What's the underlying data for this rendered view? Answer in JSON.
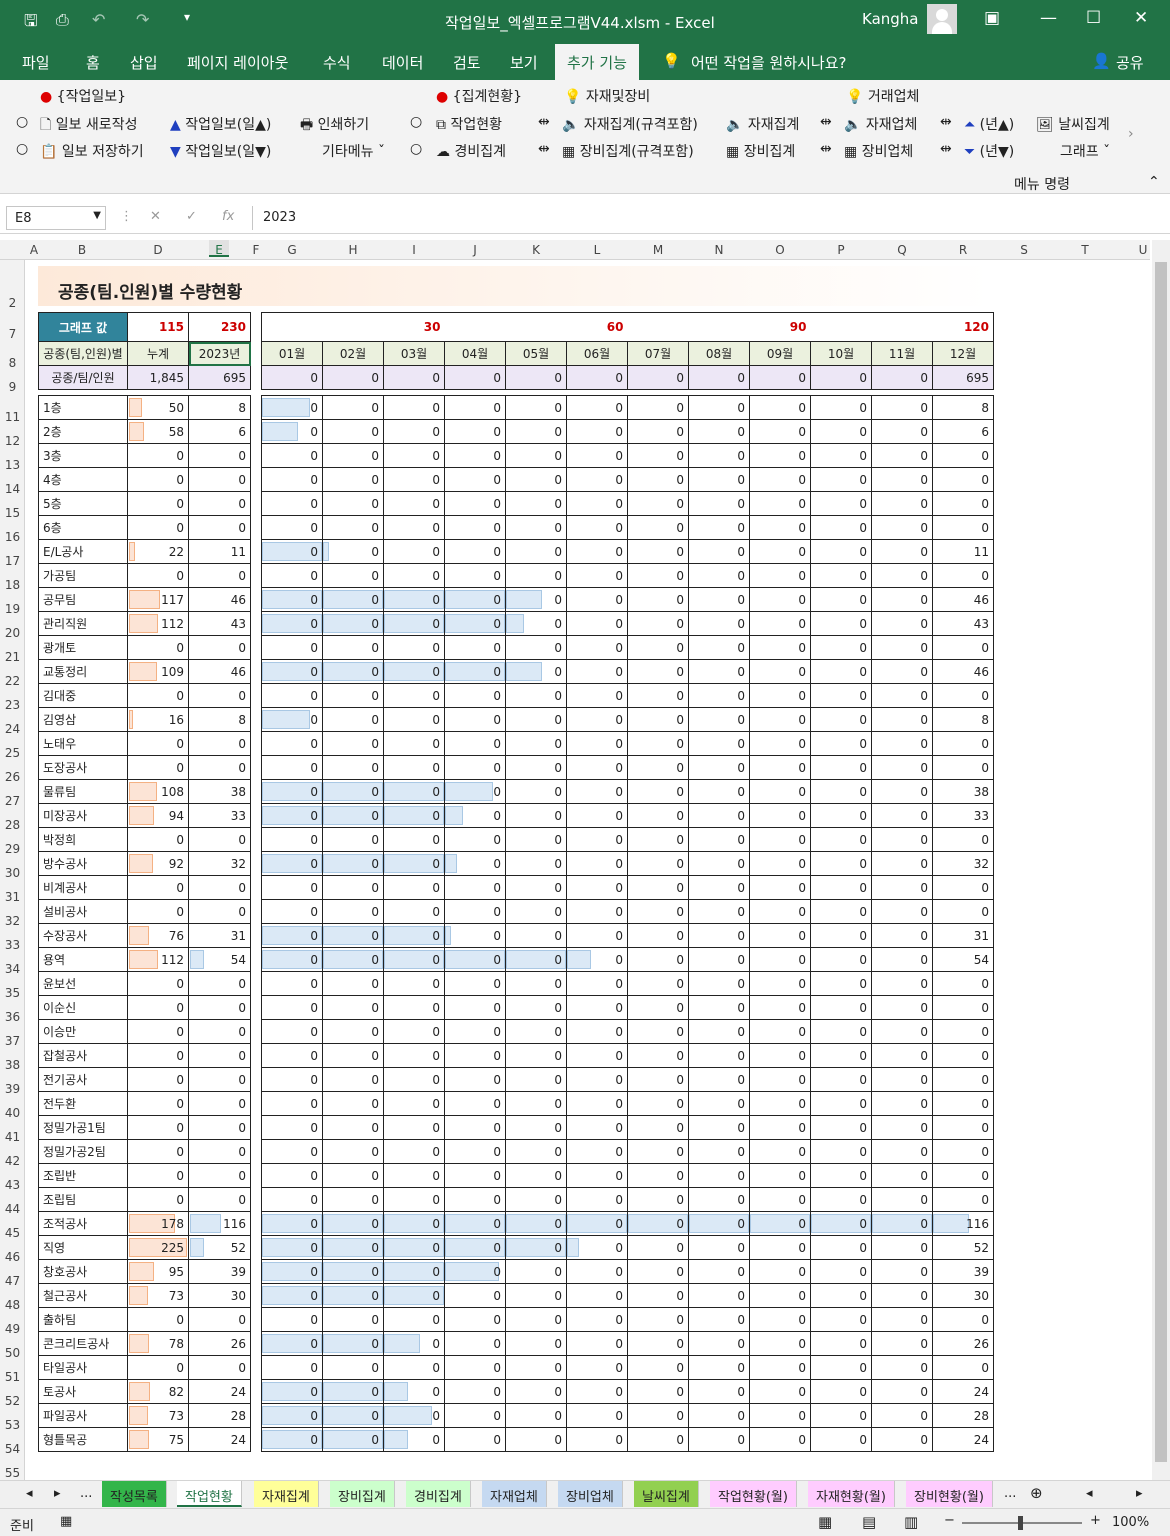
{
  "window": {
    "title": "작업일보_엑셀프로그램V44.xlsm  -  Excel",
    "user": "Kangha"
  },
  "tabs": [
    "파일",
    "홈",
    "삽입",
    "페이지 레이아웃",
    "수식",
    "데이터",
    "검토",
    "보기",
    "추가 기능"
  ],
  "tell_me": "어떤 작업을 원하시나요?",
  "share": "공유",
  "ribbon": {
    "g1_title": "{작업일보}",
    "new_report": "일보 새로작성",
    "save_report": "일보 저장하기",
    "rep_up": "작업일보(일▲)",
    "rep_down": "작업일보(일▼)",
    "print": "인쇄하기",
    "other_menu": "기타메뉴",
    "g2_title": "{집계현황}",
    "work_status": "작업현황",
    "cost_agg": "경비집계",
    "g3_title": "자재및장비",
    "mat_agg_spec": "자재집계(규격포함)",
    "mat_agg": "자재집계",
    "eq_agg_spec": "장비집계(규격포함)",
    "eq_agg": "장비집계",
    "g4_title": "거래업체",
    "mat_vendor": "자재업체",
    "eq_vendor": "장비업체",
    "year_up": "(년▲)",
    "year_down": "(년▼)",
    "weather": "날씨집계",
    "graph": "그래프",
    "menu_cmd": "메뉴 명령"
  },
  "formula": {
    "namebox": "E8",
    "value": "2023"
  },
  "columns": [
    "A",
    "B",
    "D",
    "E",
    "F",
    "G",
    "H",
    "I",
    "J",
    "K",
    "L",
    "M",
    "N",
    "O",
    "P",
    "Q",
    "R",
    "S",
    "T",
    "U"
  ],
  "sheet": {
    "title": "공종(팀.인원)별 수량현황",
    "graph_label": "그래프 값",
    "graph_values": [
      "115",
      "230"
    ],
    "scale_values": [
      "30",
      "60",
      "90",
      "120"
    ],
    "h_name": "공종(팀,인원)별",
    "h_cum": "누계",
    "h_year": "2023년",
    "months": [
      "01월",
      "02월",
      "03월",
      "04월",
      "05월",
      "06월",
      "07월",
      "08월",
      "09월",
      "10월",
      "11월",
      "12월"
    ],
    "sum_label": "공종/팀/인원",
    "sum_cum": "1,845",
    "sum_year": "695",
    "sum_months": [
      "0",
      "0",
      "0",
      "0",
      "0",
      "0",
      "0",
      "0",
      "0",
      "0",
      "0",
      "695"
    ],
    "rows": [
      {
        "r": "11",
        "name": "1층",
        "cum": 50,
        "year": 8
      },
      {
        "r": "12",
        "name": "2층",
        "cum": 58,
        "year": 6
      },
      {
        "r": "13",
        "name": "3층",
        "cum": 0,
        "year": 0
      },
      {
        "r": "14",
        "name": "4층",
        "cum": 0,
        "year": 0
      },
      {
        "r": "15",
        "name": "5층",
        "cum": 0,
        "year": 0
      },
      {
        "r": "16",
        "name": "6층",
        "cum": 0,
        "year": 0
      },
      {
        "r": "17",
        "name": "E/L공사",
        "cum": 22,
        "year": 11
      },
      {
        "r": "18",
        "name": "가공팀",
        "cum": 0,
        "year": 0
      },
      {
        "r": "19",
        "name": "공무팀",
        "cum": 117,
        "year": 46
      },
      {
        "r": "20",
        "name": "관리직원",
        "cum": 112,
        "year": 43
      },
      {
        "r": "21",
        "name": "광개토",
        "cum": 0,
        "year": 0
      },
      {
        "r": "22",
        "name": "교통정리",
        "cum": 109,
        "year": 46
      },
      {
        "r": "23",
        "name": "김대중",
        "cum": 0,
        "year": 0
      },
      {
        "r": "24",
        "name": "김영삼",
        "cum": 16,
        "year": 8
      },
      {
        "r": "25",
        "name": "노태우",
        "cum": 0,
        "year": 0
      },
      {
        "r": "26",
        "name": "도장공사",
        "cum": 0,
        "year": 0
      },
      {
        "r": "27",
        "name": "물류팀",
        "cum": 108,
        "year": 38
      },
      {
        "r": "28",
        "name": "미장공사",
        "cum": 94,
        "year": 33
      },
      {
        "r": "29",
        "name": "박정희",
        "cum": 0,
        "year": 0
      },
      {
        "r": "30",
        "name": "방수공사",
        "cum": 92,
        "year": 32
      },
      {
        "r": "31",
        "name": "비계공사",
        "cum": 0,
        "year": 0
      },
      {
        "r": "32",
        "name": "설비공사",
        "cum": 0,
        "year": 0
      },
      {
        "r": "33",
        "name": "수장공사",
        "cum": 76,
        "year": 31
      },
      {
        "r": "34",
        "name": "용역",
        "cum": 112,
        "year": 54
      },
      {
        "r": "35",
        "name": "윤보선",
        "cum": 0,
        "year": 0
      },
      {
        "r": "36",
        "name": "이순신",
        "cum": 0,
        "year": 0
      },
      {
        "r": "37",
        "name": "이승만",
        "cum": 0,
        "year": 0
      },
      {
        "r": "38",
        "name": "잡철공사",
        "cum": 0,
        "year": 0
      },
      {
        "r": "39",
        "name": "전기공사",
        "cum": 0,
        "year": 0
      },
      {
        "r": "40",
        "name": "전두환",
        "cum": 0,
        "year": 0
      },
      {
        "r": "41",
        "name": "정밀가공1팀",
        "cum": 0,
        "year": 0
      },
      {
        "r": "42",
        "name": "정밀가공2팀",
        "cum": 0,
        "year": 0
      },
      {
        "r": "43",
        "name": "조립반",
        "cum": 0,
        "year": 0
      },
      {
        "r": "44",
        "name": "조립팀",
        "cum": 0,
        "year": 0
      },
      {
        "r": "45",
        "name": "조적공사",
        "cum": 178,
        "year": 116
      },
      {
        "r": "46",
        "name": "직영",
        "cum": 225,
        "year": 52
      },
      {
        "r": "47",
        "name": "창호공사",
        "cum": 95,
        "year": 39
      },
      {
        "r": "48",
        "name": "철근공사",
        "cum": 73,
        "year": 30
      },
      {
        "r": "49",
        "name": "출하팀",
        "cum": 0,
        "year": 0
      },
      {
        "r": "50",
        "name": "콘크리트공사",
        "cum": 78,
        "year": 26
      },
      {
        "r": "51",
        "name": "타일공사",
        "cum": 0,
        "year": 0
      },
      {
        "r": "52",
        "name": "토공사",
        "cum": 82,
        "year": 24
      },
      {
        "r": "53",
        "name": "파일공사",
        "cum": 73,
        "year": 28
      },
      {
        "r": "54",
        "name": "형틀목공",
        "cum": 75,
        "year": 24
      }
    ]
  },
  "sheet_tabs": [
    {
      "label": "작성목록",
      "color": "#33b54a"
    },
    {
      "label": "작업현황",
      "color": "#ffffff"
    },
    {
      "label": "자재집계",
      "color": "#ffff99"
    },
    {
      "label": "장비집계",
      "color": "#ccffcc"
    },
    {
      "label": "경비집계",
      "color": "#ccffcc"
    },
    {
      "label": "자재업체",
      "color": "#c5d9f1"
    },
    {
      "label": "장비업체",
      "color": "#c5d9f1"
    },
    {
      "label": "날씨집계",
      "color": "#92d050"
    },
    {
      "label": "작업현황(월)",
      "color": "#ffccff"
    },
    {
      "label": "자재현황(월)",
      "color": "#ffccff"
    },
    {
      "label": "장비현황(월)",
      "color": "#ffccff"
    }
  ],
  "status": {
    "ready": "준비",
    "zoom": "100%"
  },
  "colors": {
    "excel_green": "#217346",
    "graph_btn": "#31849b",
    "header_green": "#ebf1de",
    "sum_purple": "#ede7f6",
    "bar_blue": "#dbe9f6"
  }
}
